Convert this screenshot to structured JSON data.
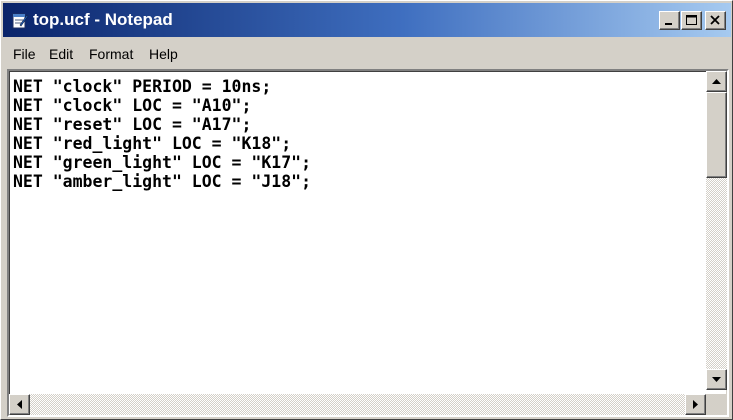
{
  "window": {
    "title": "top.ucf - Notepad",
    "app_icon": "notepad-icon",
    "controls": [
      "minimize-icon",
      "maximize-icon",
      "close-icon"
    ]
  },
  "menu": {
    "items": [
      {
        "label": "File"
      },
      {
        "label": "Edit"
      },
      {
        "label": "Format"
      },
      {
        "label": "Help"
      }
    ]
  },
  "editor": {
    "lines": [
      "NET \"clock\" PERIOD = 10ns;",
      "NET \"clock\" LOC = \"A10\";",
      "NET \"reset\" LOC = \"A17\";",
      "NET \"red_light\" LOC = \"K18\";",
      "NET \"green_light\" LOC = \"K17\";",
      "NET \"amber_light\" LOC = \"J18\";"
    ]
  },
  "colors": {
    "titlebar_start": "#0a246a",
    "titlebar_end": "#a6caf0",
    "face": "#d4d0c8",
    "text": "#000000"
  }
}
